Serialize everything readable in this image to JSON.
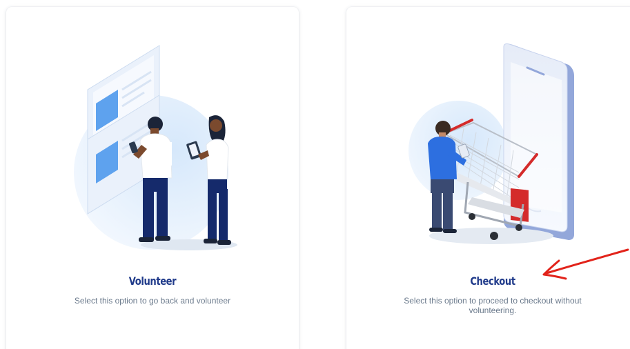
{
  "cards": [
    {
      "id": "volunteer",
      "title": "Volunteer",
      "description": "Select this option to go back and volunteer",
      "illustration": "two-people-with-phones-illustration"
    },
    {
      "id": "checkout",
      "title": "Checkout",
      "description": "Select this option to proceed to checkout without volunteering.",
      "illustration": "shopping-cart-phone-illustration"
    }
  ],
  "annotation": {
    "icon": "red-arrow-annotation",
    "color": "#e2231a"
  },
  "colors": {
    "title": "#1f3a8a",
    "description": "#6b7a8c",
    "accent_blue": "#3a86f0",
    "cart_red": "#d42b2b"
  }
}
